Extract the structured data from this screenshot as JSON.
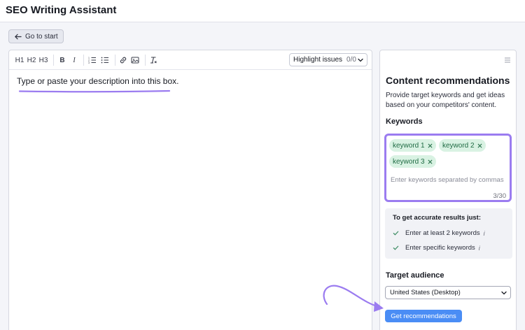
{
  "header": {
    "title": "SEO Writing Assistant"
  },
  "nav": {
    "back_label": "Go to start"
  },
  "editor": {
    "toolbar": {
      "h1": "H1",
      "h2": "H2",
      "h3": "H3",
      "bold": "B",
      "italic": "I",
      "icons": [
        "ordered-list-icon",
        "bullet-list-icon",
        "link-icon",
        "image-icon",
        "clear-format-icon"
      ]
    },
    "highlight": {
      "label": "Highlight issues",
      "count": "0/0"
    },
    "placeholder": "Type or paste your description into this box."
  },
  "panel": {
    "title": "Content recommendations",
    "description": "Provide target keywords and get ideas based on your competitors' content.",
    "keywords": {
      "heading": "Keywords",
      "chips": [
        "keyword 1",
        "keyword 2",
        "keyword 3"
      ],
      "input_placeholder": "Enter keywords separated by commas",
      "count": "3/30"
    },
    "tips": {
      "title": "To get accurate results just:",
      "items": [
        "Enter at least 2 keywords",
        "Enter specific keywords"
      ],
      "info": "i"
    },
    "target_audience": {
      "heading": "Target audience",
      "selected": "United States (Desktop)"
    },
    "submit_label": "Get recommendations"
  },
  "colors": {
    "accent_purple": "#9b7cf0",
    "button_blue": "#4a8df5",
    "chip_bg": "#d9f2e3",
    "chip_text": "#1f6b43"
  }
}
